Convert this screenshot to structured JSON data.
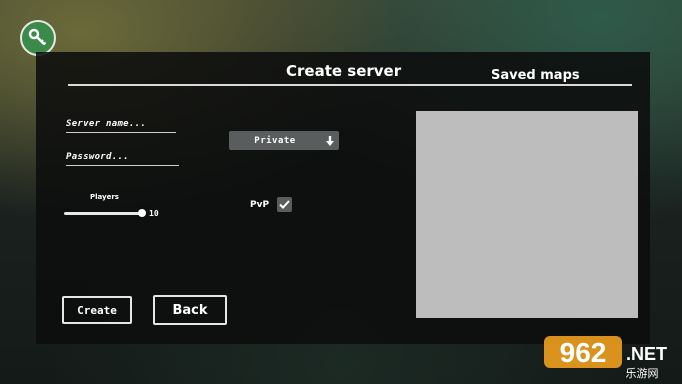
{
  "header": {
    "title": "Create server",
    "saved_maps_title": "Saved maps"
  },
  "form": {
    "server_name_placeholder": "Server name...",
    "password_placeholder": "Password...",
    "privacy_selected": "Private",
    "players_label": "Players",
    "players_value": "10",
    "players_slider_fraction": 1.0,
    "pvp_label": "PvP",
    "pvp_checked": true
  },
  "buttons": {
    "create_label": "Create",
    "back_label": "Back"
  },
  "icons": {
    "logo": "key-wrench-icon",
    "dropdown": "arrow-down-icon",
    "checkbox": "check-icon"
  },
  "colors": {
    "panel": "#0c0e0e",
    "logo_green": "#3b8a4a",
    "saved_box": "#bdbdbd",
    "control_gray": "#5a5d5d"
  },
  "watermark": {
    "brand": "962",
    "net": ".NET",
    "sub": "乐游网"
  }
}
